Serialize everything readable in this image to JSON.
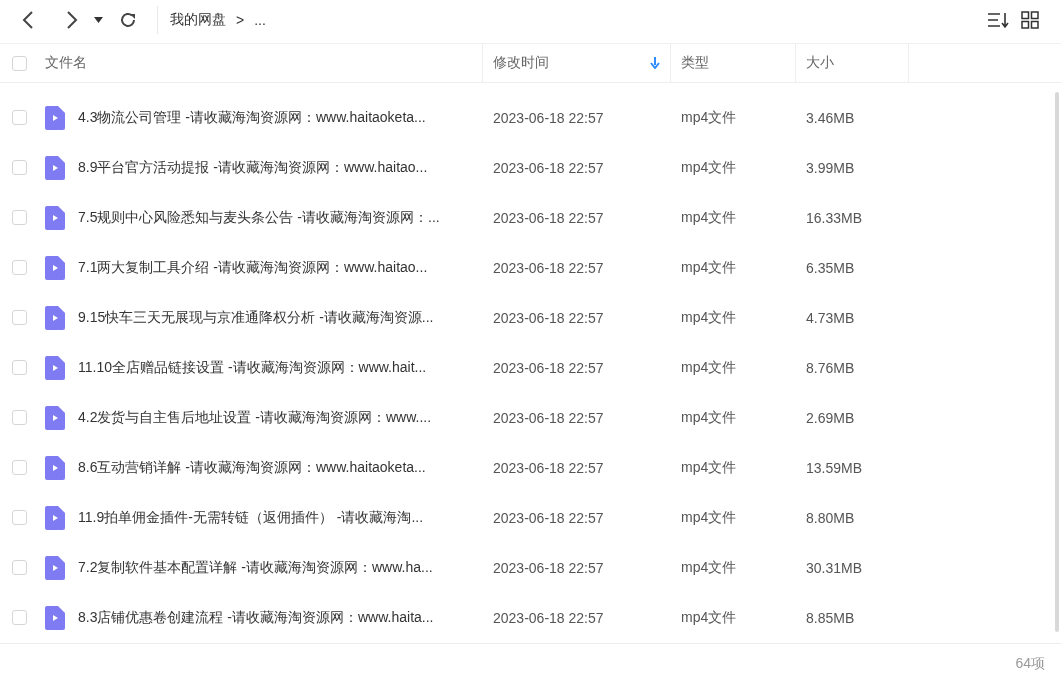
{
  "breadcrumb": [
    "我的网盘",
    ">",
    "..."
  ],
  "columns": [
    {
      "label": "文件名"
    },
    {
      "label": "修改时间",
      "sorted": true
    },
    {
      "label": "类型",
      "sorted": false
    },
    {
      "label": "大小",
      "sorted": false
    }
  ],
  "header_checked": false,
  "rows": [
    {
      "name": "4.3物流公司管理 -请收藏海淘资源网：www.haitaoketa...",
      "modified": "2023-06-18 22:57",
      "type": "mp4文件",
      "size": "3.46MB",
      "checked": false
    },
    {
      "name": "8.9平台官方活动提报 -请收藏海淘资源网：www.haitao...",
      "modified": "2023-06-18 22:57",
      "type": "mp4文件",
      "size": "3.99MB",
      "checked": false
    },
    {
      "name": "7.5规则中心风险悉知与麦头条公告 -请收藏海淘资源网：...",
      "modified": "2023-06-18 22:57",
      "type": "mp4文件",
      "size": "16.33MB",
      "checked": false
    },
    {
      "name": "7.1两大复制工具介绍 -请收藏海淘资源网：www.haitao...",
      "modified": "2023-06-18 22:57",
      "type": "mp4文件",
      "size": "6.35MB",
      "checked": false
    },
    {
      "name": "9.15快车三天无展现与京准通降权分析 -请收藏海淘资源...",
      "modified": "2023-06-18 22:57",
      "type": "mp4文件",
      "size": "4.73MB",
      "checked": false
    },
    {
      "name": "11.10全店赠品链接设置 -请收藏海淘资源网：www.hait...",
      "modified": "2023-06-18 22:57",
      "type": "mp4文件",
      "size": "8.76MB",
      "checked": false
    },
    {
      "name": "4.2发货与自主售后地址设置 -请收藏海淘资源网：www....",
      "modified": "2023-06-18 22:57",
      "type": "mp4文件",
      "size": "2.69MB",
      "checked": false
    },
    {
      "name": "8.6互动营销详解 -请收藏海淘资源网：www.haitaoketa...",
      "modified": "2023-06-18 22:57",
      "type": "mp4文件",
      "size": "13.59MB",
      "checked": false
    },
    {
      "name": "11.9拍单佣金插件-无需转链（返佣插件） -请收藏海淘...",
      "modified": "2023-06-18 22:57",
      "type": "mp4文件",
      "size": "8.80MB",
      "checked": false
    },
    {
      "name": "7.2复制软件基本配置详解 -请收藏海淘资源网：www.ha...",
      "modified": "2023-06-18 22:57",
      "type": "mp4文件",
      "size": "30.31MB",
      "checked": false
    },
    {
      "name": "8.3店铺优惠卷创建流程 -请收藏海淘资源网：www.haita...",
      "modified": "2023-06-18 22:57",
      "type": "mp4文件",
      "size": "8.85MB",
      "checked": false
    }
  ],
  "status_bar": {
    "count": "64项"
  }
}
